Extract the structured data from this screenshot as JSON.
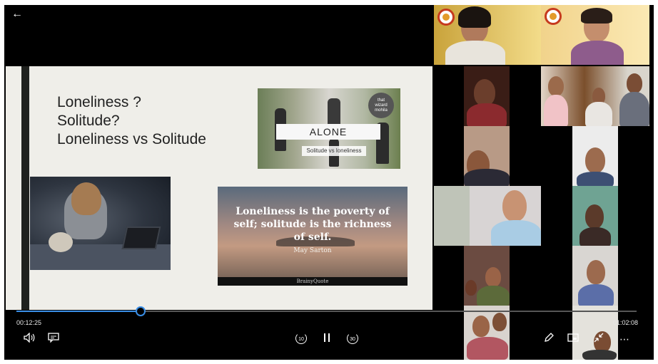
{
  "slide": {
    "title_lines": [
      "Loneliness ?",
      "Solitude?",
      "Loneliness vs Solitude"
    ],
    "alone_image": {
      "word": "ALONE",
      "caption": "Solitude vs loneliness",
      "badge_lines": [
        "that",
        "wizard",
        "mohila"
      ]
    },
    "quote_image": {
      "quote_lines": [
        "Loneliness is the poverty of",
        "self; solitude is the richness",
        "of self."
      ],
      "author": "May Sarton",
      "source": "BrainyQuote"
    }
  },
  "player": {
    "elapsed": "00:12:25",
    "duration": "01:02:08",
    "progress": 0.2,
    "skip_back_seconds": "10",
    "skip_forward_seconds": "30"
  },
  "colors": {
    "accent": "#3a8ee6",
    "slide_bg": "#efeee9"
  },
  "icons": {
    "back": "arrow-left-icon",
    "volume": "volume-icon",
    "captions": "captions-icon",
    "pause": "pause-icon",
    "edit": "pencil-icon",
    "miniview": "picture-in-picture-icon",
    "fullscreen": "exit-fullscreen-icon",
    "more": "more-icon"
  }
}
